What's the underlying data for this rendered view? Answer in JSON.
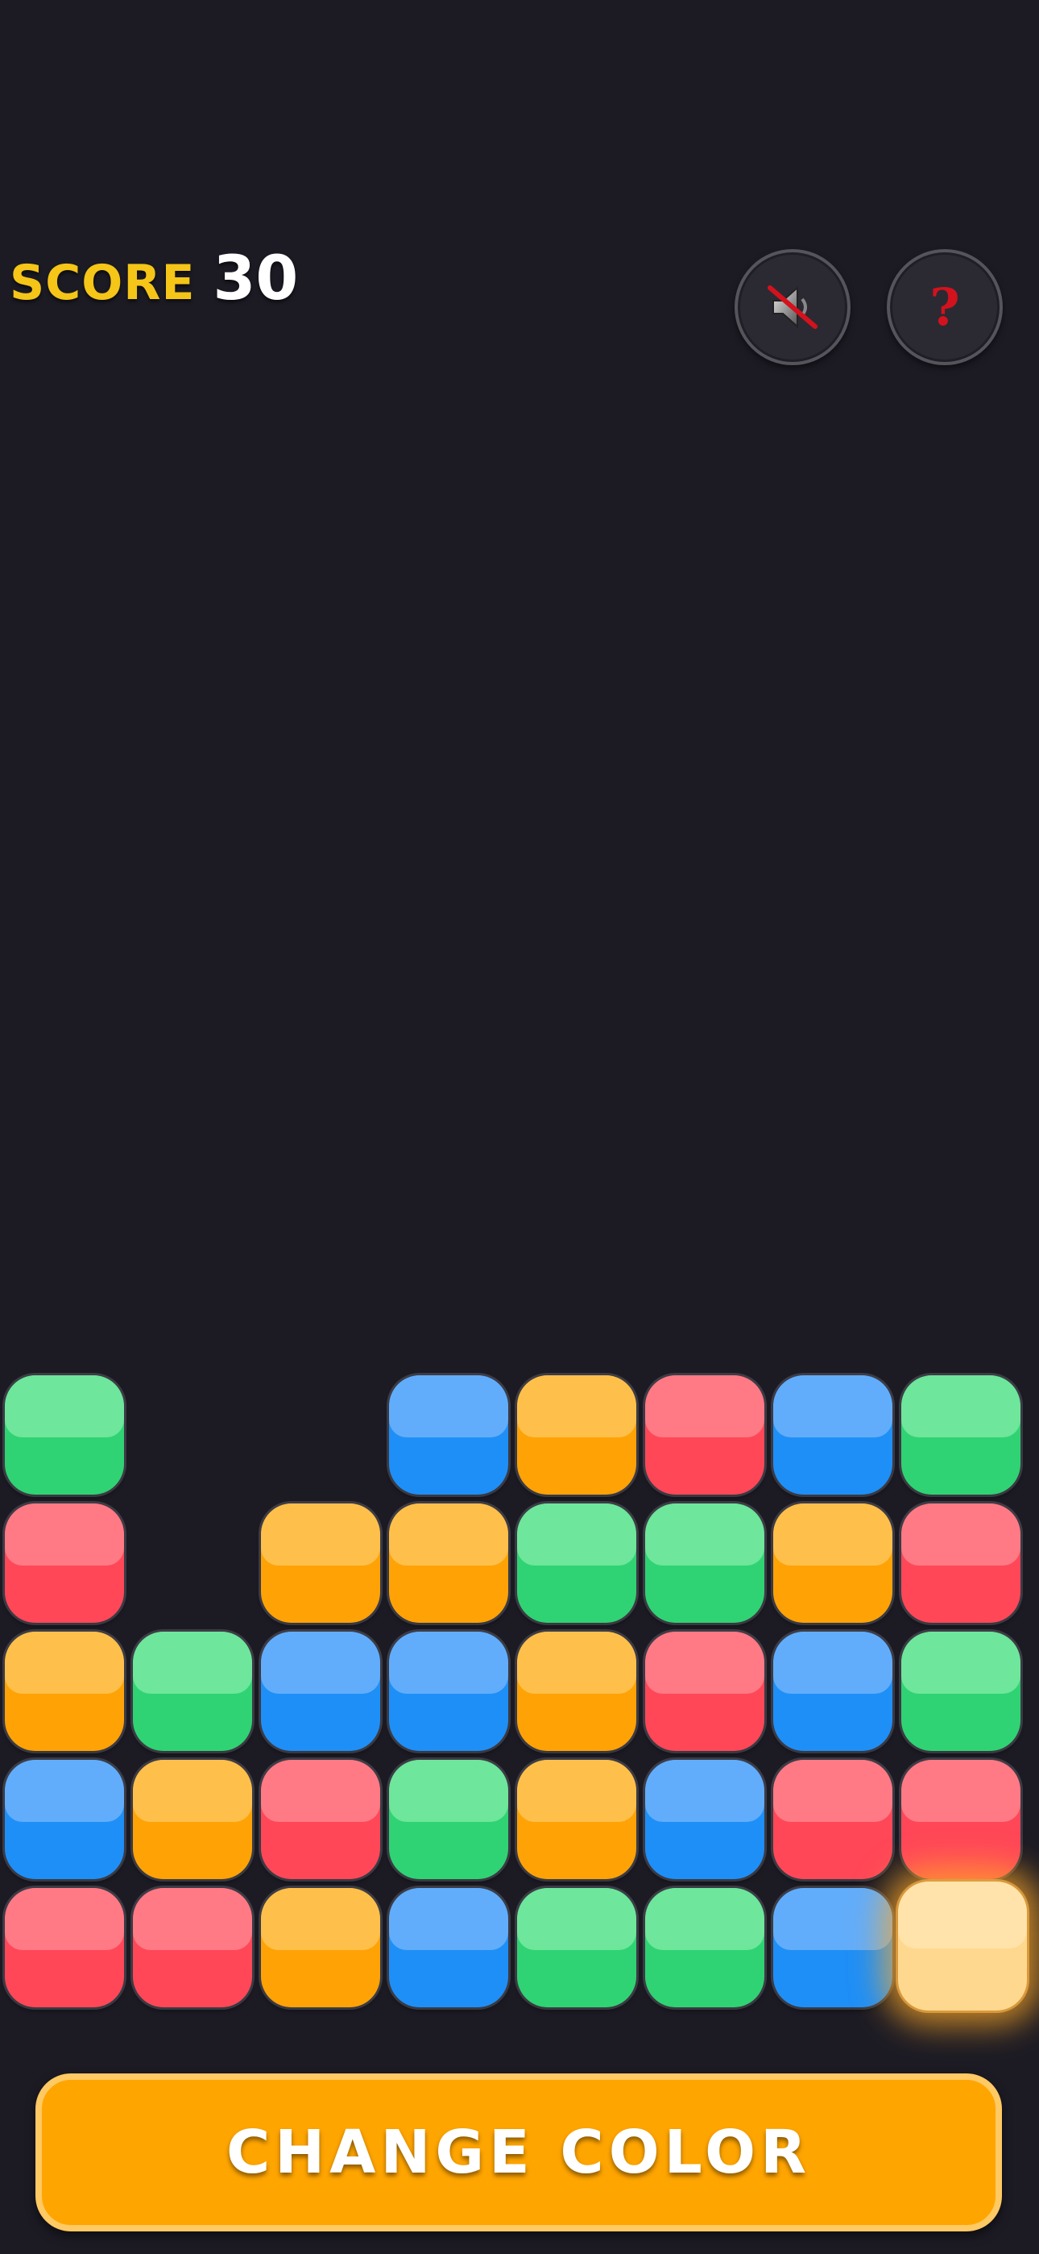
{
  "score": {
    "label": "SCORE",
    "value": "30"
  },
  "buttons": {
    "mute_icon": "speaker-muted-icon",
    "help_icon": "question-icon",
    "help_glyph": "?",
    "change_color_label": "CHANGE COLOR"
  },
  "colors": {
    "green": "#2fd373",
    "blue": "#1e8ff7",
    "orange": "#ffa206",
    "red": "#ff4758",
    "background": "#1c1b24",
    "score_label": "#f5c518",
    "button": "#ffa500"
  },
  "board": {
    "columns": 8,
    "rows": 5,
    "cells": [
      [
        "green",
        null,
        null,
        "blue",
        "orange",
        "red",
        "blue",
        "green"
      ],
      [
        "red",
        null,
        "orange",
        "orange",
        "green",
        "green",
        "orange",
        "red"
      ],
      [
        "orange",
        "green",
        "blue",
        "blue",
        "orange",
        "red",
        "blue",
        "green"
      ],
      [
        "blue",
        "orange",
        "red",
        "green",
        "orange",
        "blue",
        "red",
        "red"
      ],
      [
        "red",
        "red",
        "orange",
        "blue",
        "green",
        "green",
        "blue",
        "selected"
      ]
    ]
  }
}
